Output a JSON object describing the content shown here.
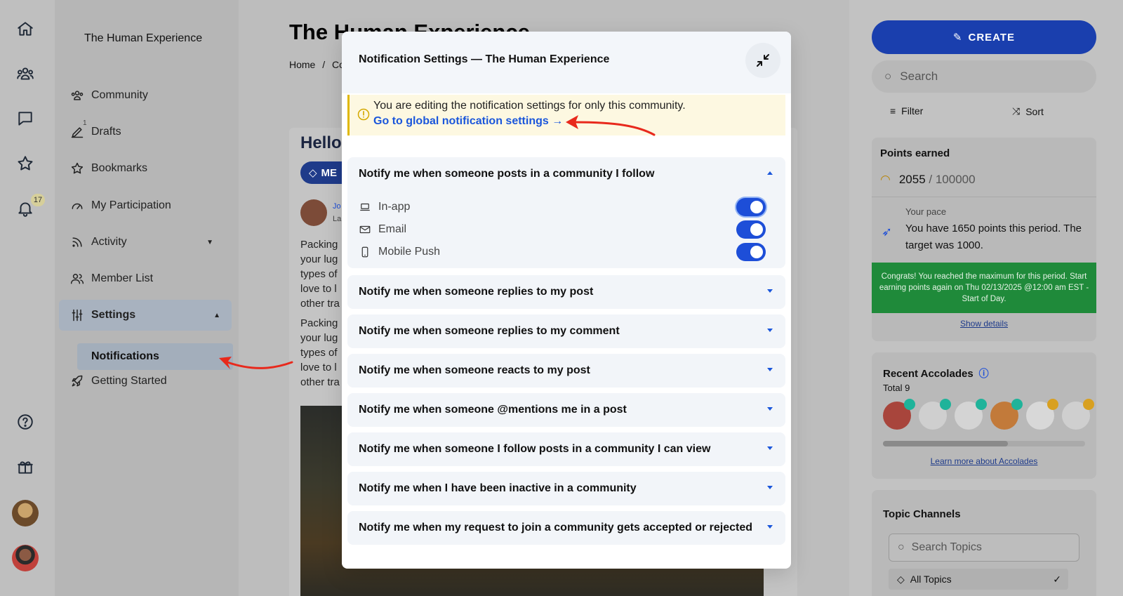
{
  "rail": {
    "badge": "17",
    "icons": [
      "home-icon",
      "community-icon",
      "chat-icon",
      "star-icon",
      "bell-icon",
      "help-icon",
      "gift-icon"
    ]
  },
  "sidebar": {
    "title": "The Human Experience",
    "items": [
      {
        "label": "Community",
        "icon": "community-icon"
      },
      {
        "label": "Drafts",
        "icon": "pencil-icon",
        "badge": "1"
      },
      {
        "label": "Bookmarks",
        "icon": "star-icon"
      },
      {
        "label": "My Participation",
        "icon": "gauge-icon"
      },
      {
        "label": "Activity",
        "icon": "rss-icon"
      },
      {
        "label": "Member List",
        "icon": "members-icon"
      },
      {
        "label": "Settings",
        "icon": "sliders-icon"
      },
      {
        "label": "Getting Started",
        "icon": "rocket-icon"
      }
    ],
    "sub_item": "Notifications"
  },
  "main": {
    "title": "The Human Experience",
    "breadcrumb_home": "Home",
    "breadcrumb_sep": "/",
    "breadcrumb_next": "Co",
    "post_title": "Hello",
    "post_tag": "ME",
    "author": "Jo",
    "author_meta": "La",
    "post_lines": [
      "Packing",
      "your lug",
      "types of",
      "love to l",
      "other tra",
      "Packing",
      "your lug",
      "types of",
      "love to l",
      "other tra"
    ]
  },
  "right": {
    "create_label": "CREATE",
    "search_placeholder": "Search",
    "filter_label": "Filter",
    "sort_label": "Sort",
    "points": {
      "title": "Points earned",
      "earned": "2055",
      "total": "/ 100000",
      "pace_label": "Your pace",
      "pace_text": "You have 1650 points this period. The target was 1000.",
      "congrats": "Congrats! You reached the maximum for this period. Start earning points again on Thu 02/13/2025 @12:00 am EST - Start of Day.",
      "details_link": "Show details"
    },
    "accolades": {
      "title": "Recent Accolades",
      "total": "Total 9",
      "link": "Learn more about Accolades"
    },
    "topics": {
      "title": "Topic Channels",
      "search_placeholder": "Search Topics",
      "all_label": "All Topics"
    }
  },
  "modal": {
    "title": "Notification Settings — The Human Experience",
    "notice_text": "You are editing the notification settings for only this community.",
    "notice_link": "Go to global notification settings →",
    "sections": [
      {
        "label": "Notify me when someone posts in a community I follow",
        "expanded": true
      },
      {
        "label": "Notify me when someone replies to my post",
        "expanded": false
      },
      {
        "label": "Notify me when someone replies to my comment",
        "expanded": false
      },
      {
        "label": "Notify me when someone reacts to my post",
        "expanded": false
      },
      {
        "label": "Notify me when someone @mentions me in a post",
        "expanded": false
      },
      {
        "label": "Notify me when someone I follow posts in a community I can view",
        "expanded": false
      },
      {
        "label": "Notify me when I have been inactive in a community",
        "expanded": false
      },
      {
        "label": "Notify me when my request to join a community gets accepted or rejected",
        "expanded": false
      }
    ],
    "channels": [
      {
        "label": "In-app",
        "icon": "laptop-icon",
        "enabled": true
      },
      {
        "label": "Email",
        "icon": "mail-icon",
        "enabled": true
      },
      {
        "label": "Mobile Push",
        "icon": "phone-icon",
        "enabled": true
      }
    ]
  },
  "colors": {
    "accent": "#1d4ed8",
    "notice_bg": "#fdf8e1",
    "notice_border": "#e0b800",
    "annotation_arrow": "#e8291c"
  }
}
